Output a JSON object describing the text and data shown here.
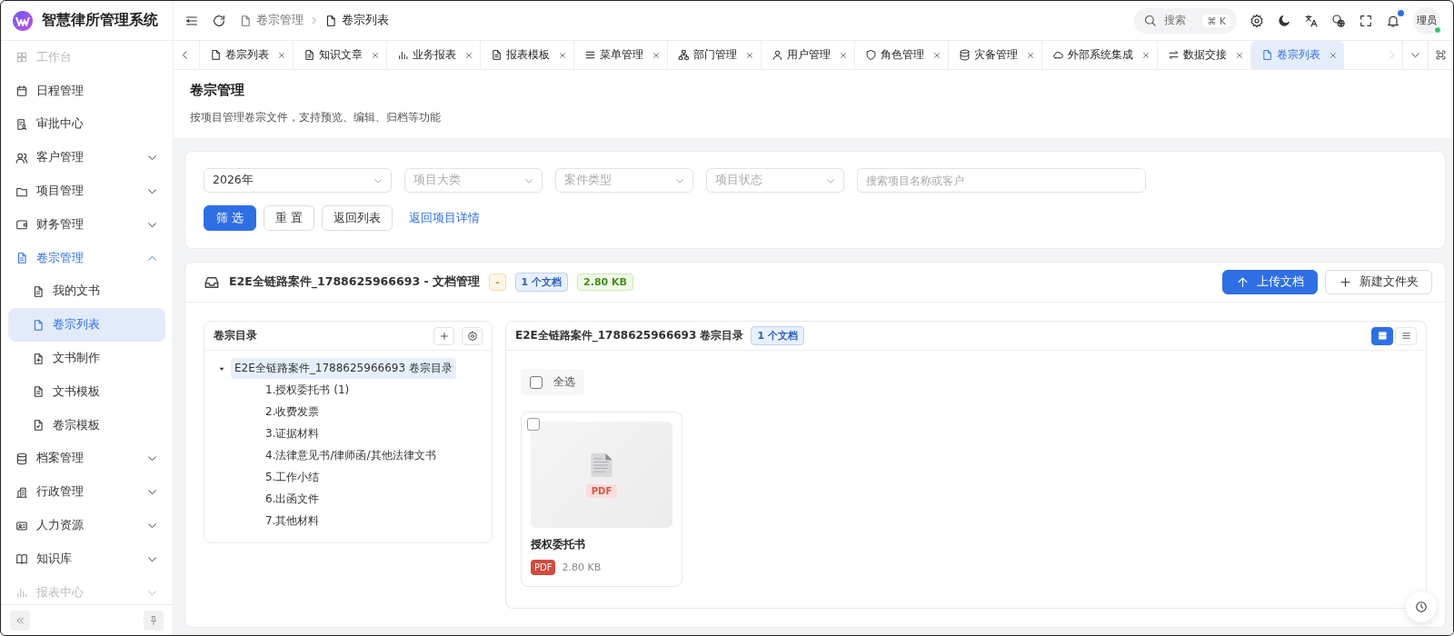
{
  "app": {
    "title": "智慧律所管理系统"
  },
  "header": {
    "breadcrumb": [
      {
        "label": "卷宗管理",
        "selected": false
      },
      {
        "label": "卷宗列表",
        "selected": true
      }
    ],
    "search": {
      "placeholder": "搜索",
      "shortcut": "⌘ K"
    },
    "notifications": {
      "unread": true
    },
    "user": {
      "avatar_text": "理员",
      "online": true
    }
  },
  "sidebar": {
    "items": [
      {
        "label": "工作台",
        "kind": "link",
        "selected": false,
        "faded": true
      },
      {
        "label": "日程管理",
        "kind": "link",
        "selected": false,
        "faded": false
      },
      {
        "label": "审批中心",
        "kind": "link",
        "selected": false,
        "faded": false
      },
      {
        "label": "客户管理",
        "kind": "group",
        "expanded": false,
        "selected": false,
        "faded": false
      },
      {
        "label": "项目管理",
        "kind": "group",
        "expanded": false,
        "selected": false,
        "faded": false
      },
      {
        "label": "财务管理",
        "kind": "group",
        "expanded": false,
        "selected": false,
        "faded": false
      },
      {
        "label": "卷宗管理",
        "kind": "group",
        "expanded": true,
        "selected": true,
        "faded": false,
        "children": [
          {
            "label": "我的文书",
            "selected": false
          },
          {
            "label": "卷宗列表",
            "selected": true
          },
          {
            "label": "文书制作",
            "selected": false
          },
          {
            "label": "文书模板",
            "selected": false
          },
          {
            "label": "卷宗模板",
            "selected": false
          }
        ]
      },
      {
        "label": "档案管理",
        "kind": "group",
        "expanded": false,
        "selected": false,
        "faded": false
      },
      {
        "label": "行政管理",
        "kind": "group",
        "expanded": false,
        "selected": false,
        "faded": false
      },
      {
        "label": "人力资源",
        "kind": "group",
        "expanded": false,
        "selected": false,
        "faded": false
      },
      {
        "label": "知识库",
        "kind": "group",
        "expanded": false,
        "selected": false,
        "faded": false
      },
      {
        "label": "报表中心",
        "kind": "group",
        "expanded": false,
        "selected": false,
        "faded": true
      }
    ]
  },
  "tabs": [
    {
      "label": "卷宗列表",
      "selected": false
    },
    {
      "label": "知识文章",
      "selected": false
    },
    {
      "label": "业务报表",
      "selected": false
    },
    {
      "label": "报表模板",
      "selected": false
    },
    {
      "label": "菜单管理",
      "selected": false
    },
    {
      "label": "部门管理",
      "selected": false
    },
    {
      "label": "用户管理",
      "selected": false
    },
    {
      "label": "角色管理",
      "selected": false
    },
    {
      "label": "灾备管理",
      "selected": false
    },
    {
      "label": "外部系统集成",
      "selected": false
    },
    {
      "label": "数据交接",
      "selected": false
    },
    {
      "label": "卷宗列表",
      "selected": true
    }
  ],
  "page": {
    "title": "卷宗管理",
    "description": "按项目管理卷宗文件，支持预览、编辑、归档等功能"
  },
  "filters": {
    "selects": [
      {
        "value": "2026年"
      },
      {
        "placeholder": "项目大类"
      },
      {
        "placeholder": "案件类型"
      },
      {
        "placeholder": "项目状态"
      }
    ],
    "search": {
      "placeholder": "搜索项目名称或客户"
    },
    "buttons": [
      {
        "label": "筛 选",
        "kind": "primary"
      },
      {
        "label": "重 置",
        "kind": "default"
      },
      {
        "label": "返回列表",
        "kind": "default"
      },
      {
        "label": "返回项目详情",
        "kind": "link"
      }
    ]
  },
  "documents": {
    "title": "E2E全链路案件_1788625966693 - 文档管理",
    "badges": [
      {
        "text": "-",
        "kind": "warning"
      },
      {
        "text": "1 个文档",
        "kind": "info"
      },
      {
        "text": "2.80 KB",
        "kind": "success"
      }
    ],
    "buttons": [
      {
        "label": "上传文档",
        "kind": "primary"
      },
      {
        "label": "新建文件夹",
        "kind": "default"
      }
    ],
    "tree": {
      "title": "卷宗目录",
      "root": {
        "label": "E2E全链路案件_1788625966693 卷宗目录",
        "expanded": true,
        "selected": true,
        "children": [
          {
            "label": "1.授权委托书 (1)"
          },
          {
            "label": "2.收费发票"
          },
          {
            "label": "3.证据材料"
          },
          {
            "label": "4.法律意见书/律师函/其他法律文书"
          },
          {
            "label": "5.工作小结"
          },
          {
            "label": "6.出函文件"
          },
          {
            "label": "7.其他材料"
          }
        ]
      }
    },
    "files_panel": {
      "title": "E2E全链路案件_1788625966693 卷宗目录",
      "count": "1 个文档",
      "views": [
        {
          "kind": "grid",
          "selected": true
        },
        {
          "kind": "list",
          "selected": false
        }
      ],
      "select_all": {
        "label": "全选",
        "checked": false
      },
      "files": [
        {
          "name": "授权委托书",
          "thumb_label": "PDF",
          "type": "PDF",
          "size": "2.80 KB",
          "checked": false
        }
      ]
    }
  }
}
